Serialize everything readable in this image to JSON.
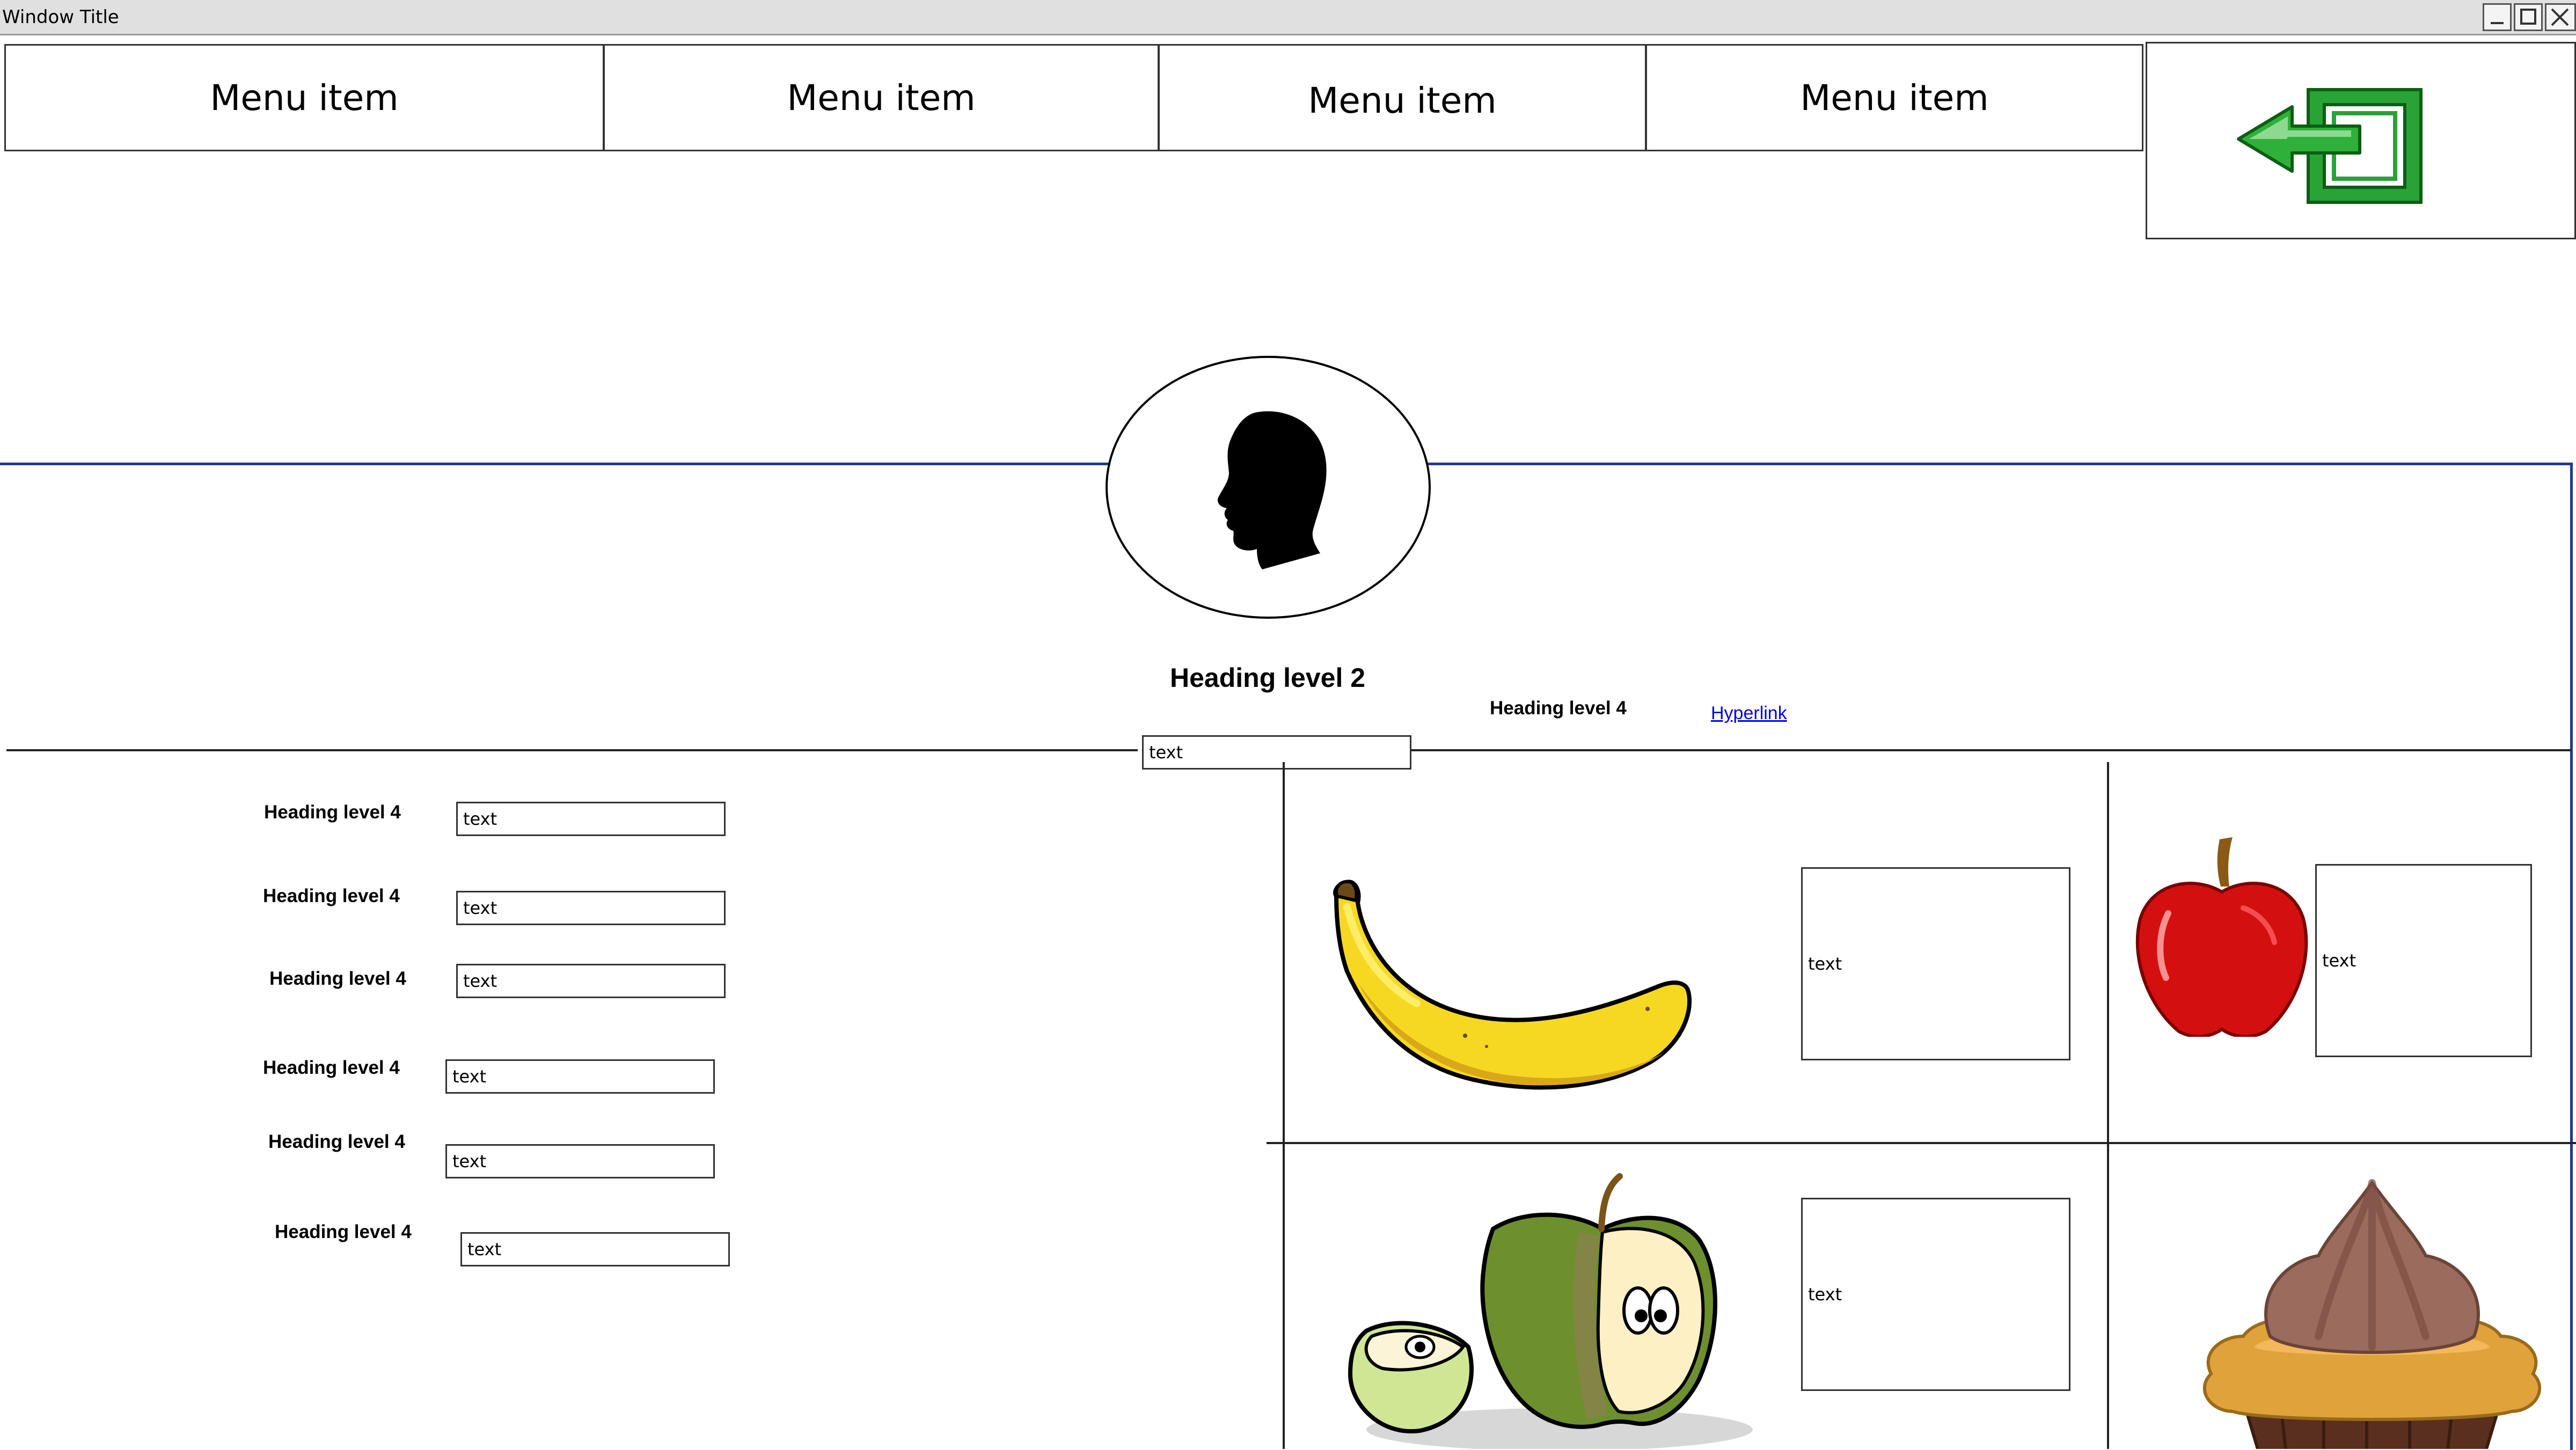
{
  "window": {
    "title": "Window Title"
  },
  "menu": {
    "items": [
      "Menu item",
      "Menu item",
      "Menu item",
      "Menu item"
    ]
  },
  "profile": {
    "heading": "Heading level 2",
    "subheading": "Heading level 4",
    "link": "Hyperlink",
    "input_value": "text"
  },
  "form": {
    "rows": [
      {
        "label": "Heading level 4",
        "value": "text"
      },
      {
        "label": "Heading level 4",
        "value": "text"
      },
      {
        "label": "Heading level 4",
        "value": "text"
      },
      {
        "label": "Heading level 4",
        "value": "text"
      },
      {
        "label": "Heading level 4",
        "value": "text"
      },
      {
        "label": "Heading level 4",
        "value": "text"
      }
    ]
  },
  "products": {
    "banana": {
      "text": "text"
    },
    "apple": {
      "text": "text"
    },
    "apple_slices": {
      "text": "text"
    }
  },
  "icons": {
    "logout": "logout-arrow-icon",
    "avatar": "head-silhouette-icon",
    "minimize": "minimize-icon",
    "maximize": "maximize-icon",
    "close": "close-icon"
  },
  "colors": {
    "accent_line": "#1f3a8a",
    "link": "#0000ee",
    "logout_green": "#22a32a"
  }
}
